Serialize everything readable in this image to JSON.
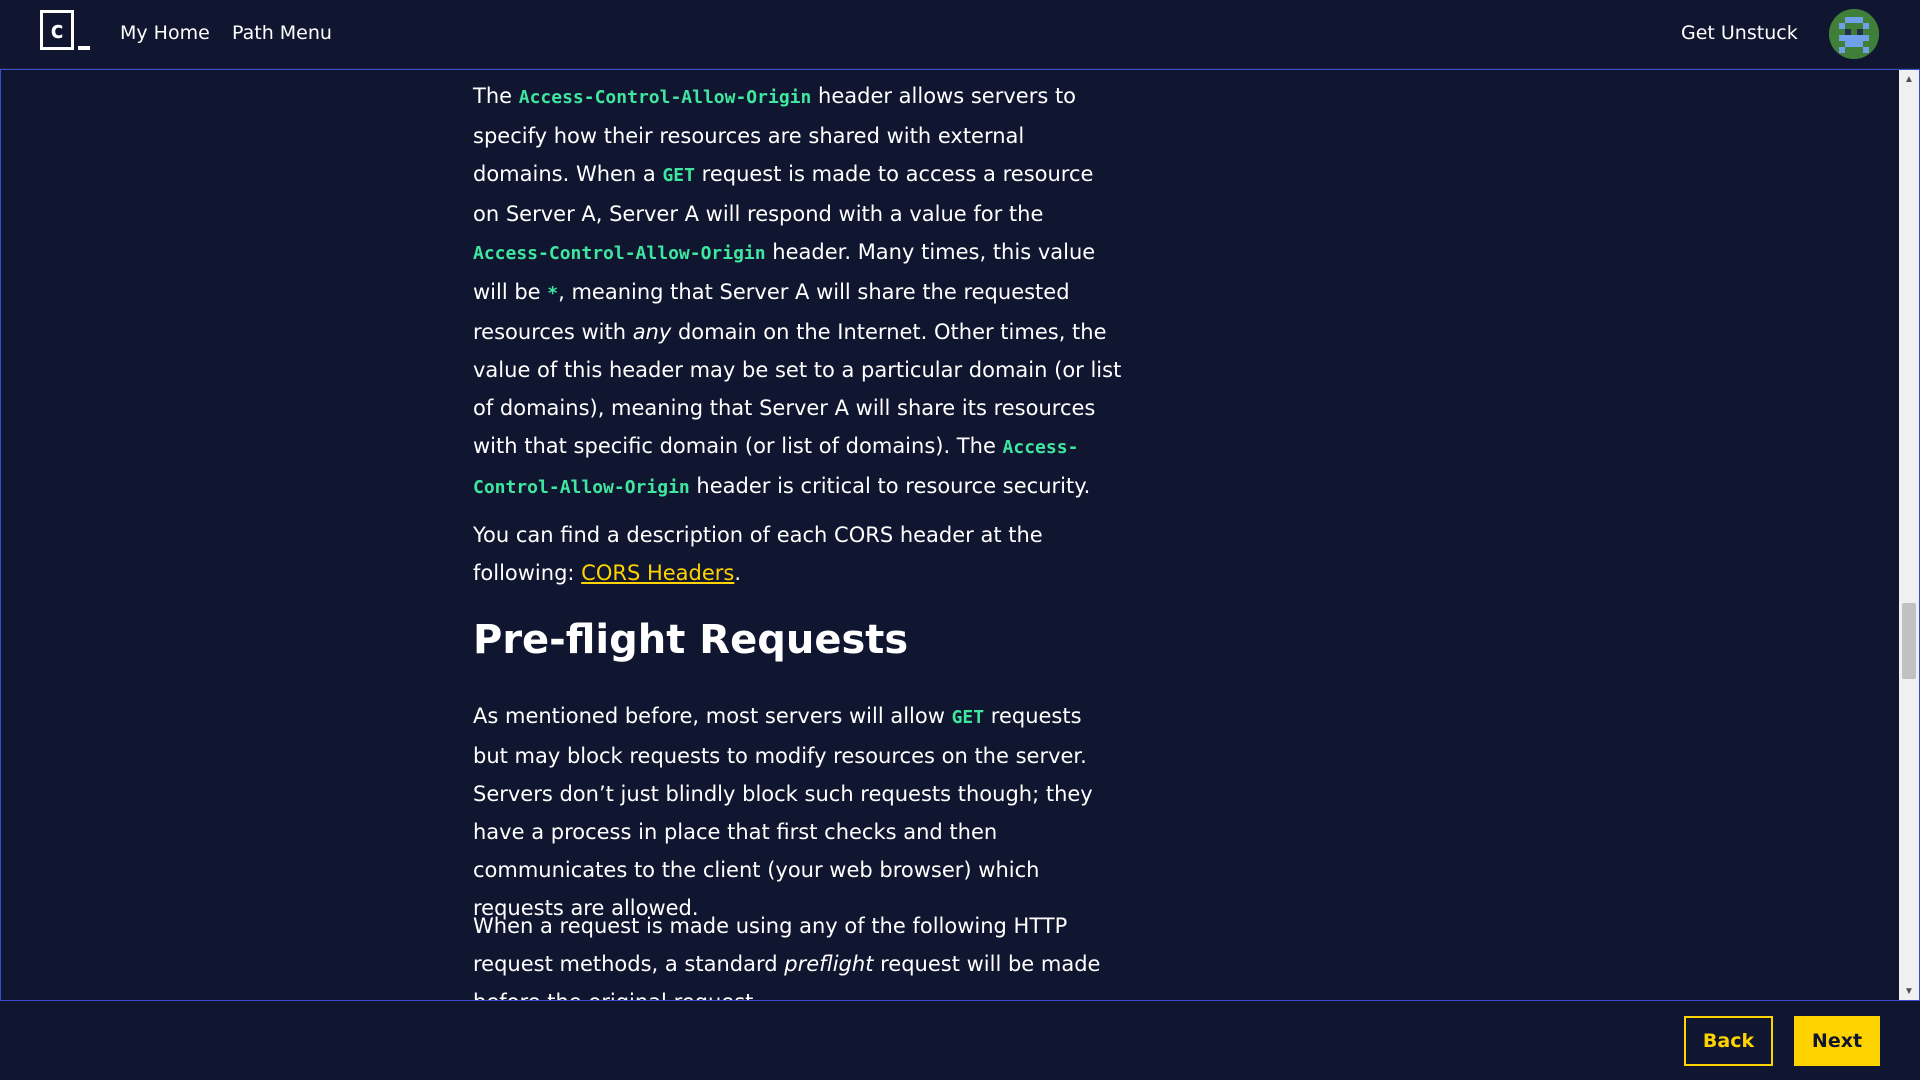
{
  "nav": {
    "my_home": "My Home",
    "path_menu": "Path Menu",
    "get_unstuck": "Get Unstuck",
    "logo_icon": "codecademy-logo-icon",
    "avatar_icon": "user-avatar-icon"
  },
  "article": {
    "p1": {
      "t1": "The ",
      "c1": "Access-Control-Allow-Origin",
      "t2": " header allows servers to specify how their resources are shared with external domains. When a ",
      "c2": "GET",
      "t3": " request is made to access a resource on Server A, Server A will respond with a value for the ",
      "c3": "Access-Control-Allow-Origin",
      "t4": " header. Many times, this value will be ",
      "c4": "*",
      "t5": ", meaning that Server A will share the requested resources with ",
      "em1": "any",
      "t6": " domain on the Internet. Other times, the value of this header may be set to a particular domain (or list of domains), meaning that Server A will share its resources with that specific domain (or list of domains). The ",
      "c5": "Access-Control-Allow-Origin",
      "t7": " header is critical to resource security."
    },
    "p2": {
      "t1": "You can find a description of each CORS header at the following: ",
      "link": "CORS Headers",
      "t2": "."
    },
    "heading": "Pre-flight Requests",
    "p3": {
      "t1": "As mentioned before, most servers will allow ",
      "c1": "GET",
      "t2": " requests but may block requests to modify resources on the server. Servers don’t just blindly block such requests though; they have a process in place that first checks and then communicates to the client (your web browser) which requests are allowed."
    },
    "p4": {
      "t1": "When a request is made using any of the following HTTP request methods, a standard ",
      "em1": "preflight",
      "t2": " request will be made before the original request."
    }
  },
  "footer": {
    "back": "Back",
    "next": "Next"
  },
  "colors": {
    "background": "#10162f",
    "accent": "#ffd300",
    "code": "#3ee6a0"
  }
}
